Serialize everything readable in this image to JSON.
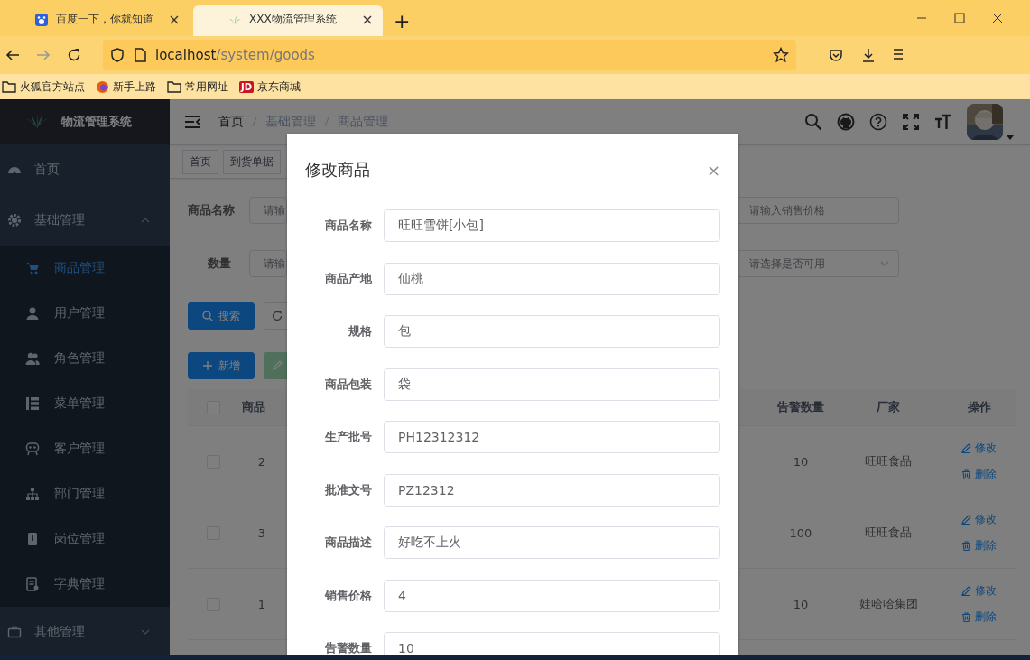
{
  "browser": {
    "tabs": [
      {
        "title": "百度一下，你就知道",
        "selected": false
      },
      {
        "title": "XXX物流管理系统",
        "selected": true
      }
    ],
    "new_tab": "+",
    "url": {
      "host": "localhost",
      "path": "/system/goods"
    },
    "bookmarks": [
      {
        "label": "火狐官方站点",
        "kind": "folder"
      },
      {
        "label": "新手上路",
        "kind": "firefox"
      },
      {
        "label": "常用网址",
        "kind": "folder"
      },
      {
        "label": "京东商城",
        "kind": "jd",
        "badge": "JD"
      }
    ]
  },
  "app": {
    "title": "物流管理系统",
    "sidebar": [
      {
        "label": "首页",
        "selected": false
      },
      {
        "label": "基础管理",
        "selected": false,
        "expanded": true,
        "children": [
          {
            "label": "商品管理",
            "selected": true
          },
          {
            "label": "用户管理",
            "selected": false
          },
          {
            "label": "角色管理",
            "selected": false
          },
          {
            "label": "菜单管理",
            "selected": false
          },
          {
            "label": "客户管理",
            "selected": false
          },
          {
            "label": "部门管理",
            "selected": false
          },
          {
            "label": "岗位管理",
            "selected": false
          },
          {
            "label": "字典管理",
            "selected": false
          }
        ]
      },
      {
        "label": "其他管理",
        "selected": false,
        "expanded": false
      }
    ],
    "breadcrumb": [
      "首页",
      "基础管理",
      "商品管理"
    ],
    "tags": [
      {
        "label": "首页",
        "selected": false
      },
      {
        "label": "到货单据",
        "selected": false
      }
    ],
    "search_form": {
      "left": [
        {
          "label": "商品名称",
          "placeholder": "请输"
        },
        {
          "label": "数量",
          "placeholder": "请输"
        }
      ],
      "right": [
        {
          "kind": "input",
          "placeholder": "请输入销售价格"
        },
        {
          "kind": "select",
          "placeholder": "请选择是否可用"
        }
      ]
    },
    "buttons": {
      "search": "搜索",
      "add": "新增"
    },
    "table": {
      "header_checked": false,
      "columns": [
        "商品",
        "告警数量",
        "厂家",
        "操作"
      ],
      "rows": [
        {
          "checked": false,
          "column_1": "2",
          "alert_qty": "10",
          "maker": "旺旺食品",
          "actions": [
            "修改",
            "删除"
          ]
        },
        {
          "checked": false,
          "column_1": "3",
          "alert_qty": "100",
          "maker": "旺旺食品",
          "actions": [
            "修改",
            "删除"
          ]
        },
        {
          "checked": false,
          "column_1": "1",
          "alert_qty": "10",
          "maker": "娃哈哈集团",
          "actions": [
            "修改",
            "删除"
          ]
        }
      ]
    }
  },
  "dialog": {
    "title": "修改商品",
    "close": "×",
    "fields": [
      {
        "label": "商品名称",
        "value": "旺旺雪饼[小包]"
      },
      {
        "label": "商品产地",
        "value": "仙桃"
      },
      {
        "label": "规格",
        "value": "包"
      },
      {
        "label": "商品包装",
        "value": "袋"
      },
      {
        "label": "生产批号",
        "value": "PH12312312"
      },
      {
        "label": "批准文号",
        "value": "PZ12312"
      },
      {
        "label": "商品描述",
        "value": "好吃不上火"
      },
      {
        "label": "销售价格",
        "value": "4"
      },
      {
        "label": "告警数量",
        "value": "10"
      }
    ]
  }
}
